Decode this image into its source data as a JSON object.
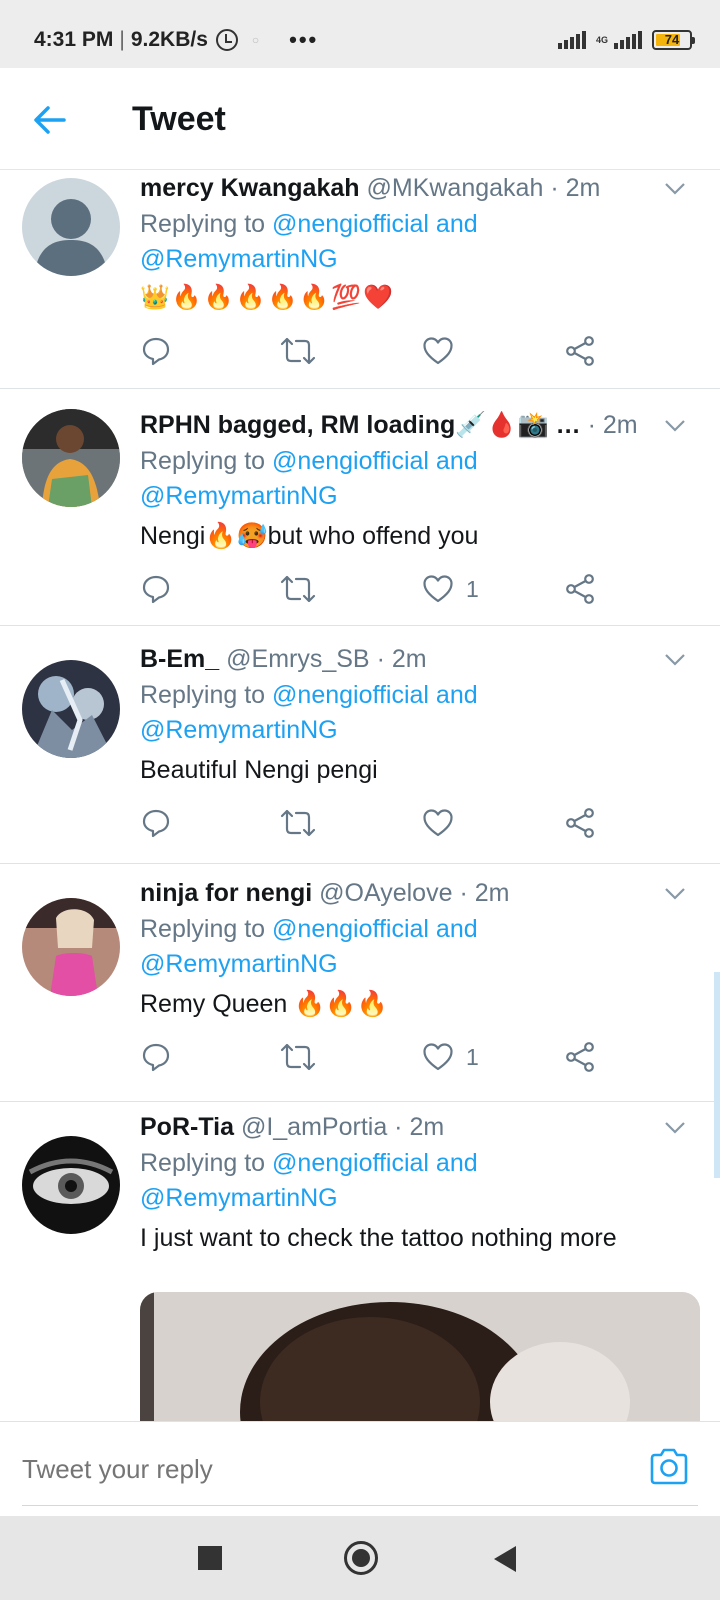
{
  "status": {
    "time": "4:31 PM",
    "speed": "9.2KB/s",
    "network": "4G",
    "battery": "74",
    "more": "•••"
  },
  "header": {
    "title": "Tweet"
  },
  "tweets": [
    {
      "name": "mercy Kwangakah",
      "handle": "@MKwangakah",
      "time": "· 2m",
      "replying": "Replying to",
      "mention1": "@nengiofficial and",
      "mention2": "@RemymartinNG",
      "text": "👑🔥🔥🔥🔥🔥💯❤️",
      "likes": ""
    },
    {
      "name": "RPHN bagged, RM loading💉🩸📸 …",
      "handle": "",
      "time": "· 2m",
      "replying": "Replying to",
      "mention1": "@nengiofficial and",
      "mention2": "@RemymartinNG",
      "text": "Nengi🔥🥵but who offend you",
      "likes": "1"
    },
    {
      "name": "B-Em_",
      "handle": "@Emrys_SB",
      "time": "· 2m",
      "replying": "Replying to",
      "mention1": "@nengiofficial and",
      "mention2": "@RemymartinNG",
      "text": "Beautiful Nengi pengi",
      "likes": ""
    },
    {
      "name": "ninja for nengi",
      "handle": "@OAyelove",
      "time": "· 2m",
      "replying": "Replying to",
      "mention1": "@nengiofficial and",
      "mention2": "@RemymartinNG",
      "text": "Remy Queen 🔥🔥🔥",
      "likes": "1"
    },
    {
      "name": "PoR-Tia",
      "handle": "@I_amPortia",
      "time": "· 2m",
      "replying": "Replying to",
      "mention1": "@nengiofficial and",
      "mention2": "@RemymartinNG",
      "text": "I just want to check the tattoo nothing more",
      "likes": ""
    }
  ],
  "reply": {
    "placeholder": "Tweet your reply"
  },
  "colors": {
    "accent": "#1da1f2",
    "text": "#14171a",
    "muted": "#657786"
  }
}
